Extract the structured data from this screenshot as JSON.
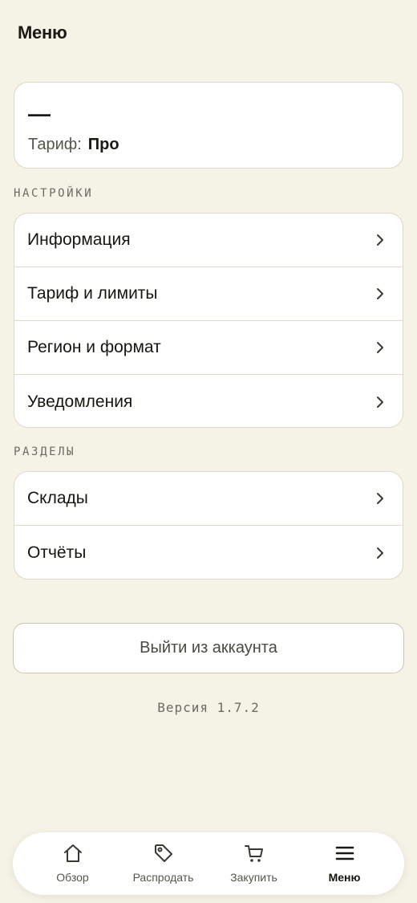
{
  "header": {
    "title": "Меню"
  },
  "profile": {
    "name": "—",
    "plan_label": "Тариф:",
    "plan_value": "Про"
  },
  "settings": {
    "label": "НАСТРОЙКИ",
    "items": [
      {
        "label": "Информация",
        "icon": "chevron-right-icon"
      },
      {
        "label": "Тариф и лимиты",
        "icon": "chevron-right-icon"
      },
      {
        "label": "Регион и формат",
        "icon": "chevron-right-icon"
      },
      {
        "label": "Уведомления",
        "icon": "chevron-right-icon"
      }
    ]
  },
  "sections": {
    "label": "РАЗДЕЛЫ",
    "items": [
      {
        "label": "Склады",
        "icon": "chevron-right-icon"
      },
      {
        "label": "Отчёты",
        "icon": "chevron-right-icon"
      }
    ]
  },
  "logout_label": "Выйти из аккаунта",
  "version": "Версия 1.7.2",
  "tabbar": {
    "items": [
      {
        "label": "Обзор",
        "icon": "home-icon",
        "active": false
      },
      {
        "label": "Распродать",
        "icon": "tag-icon",
        "active": false
      },
      {
        "label": "Закупить",
        "icon": "cart-icon",
        "active": false
      },
      {
        "label": "Меню",
        "icon": "menu-icon",
        "active": true
      }
    ]
  },
  "colors": {
    "background": "#f5f2e6",
    "card": "#ffffff",
    "border": "#dcd9c6",
    "text": "#1a1a14",
    "muted": "#6d6c60"
  }
}
